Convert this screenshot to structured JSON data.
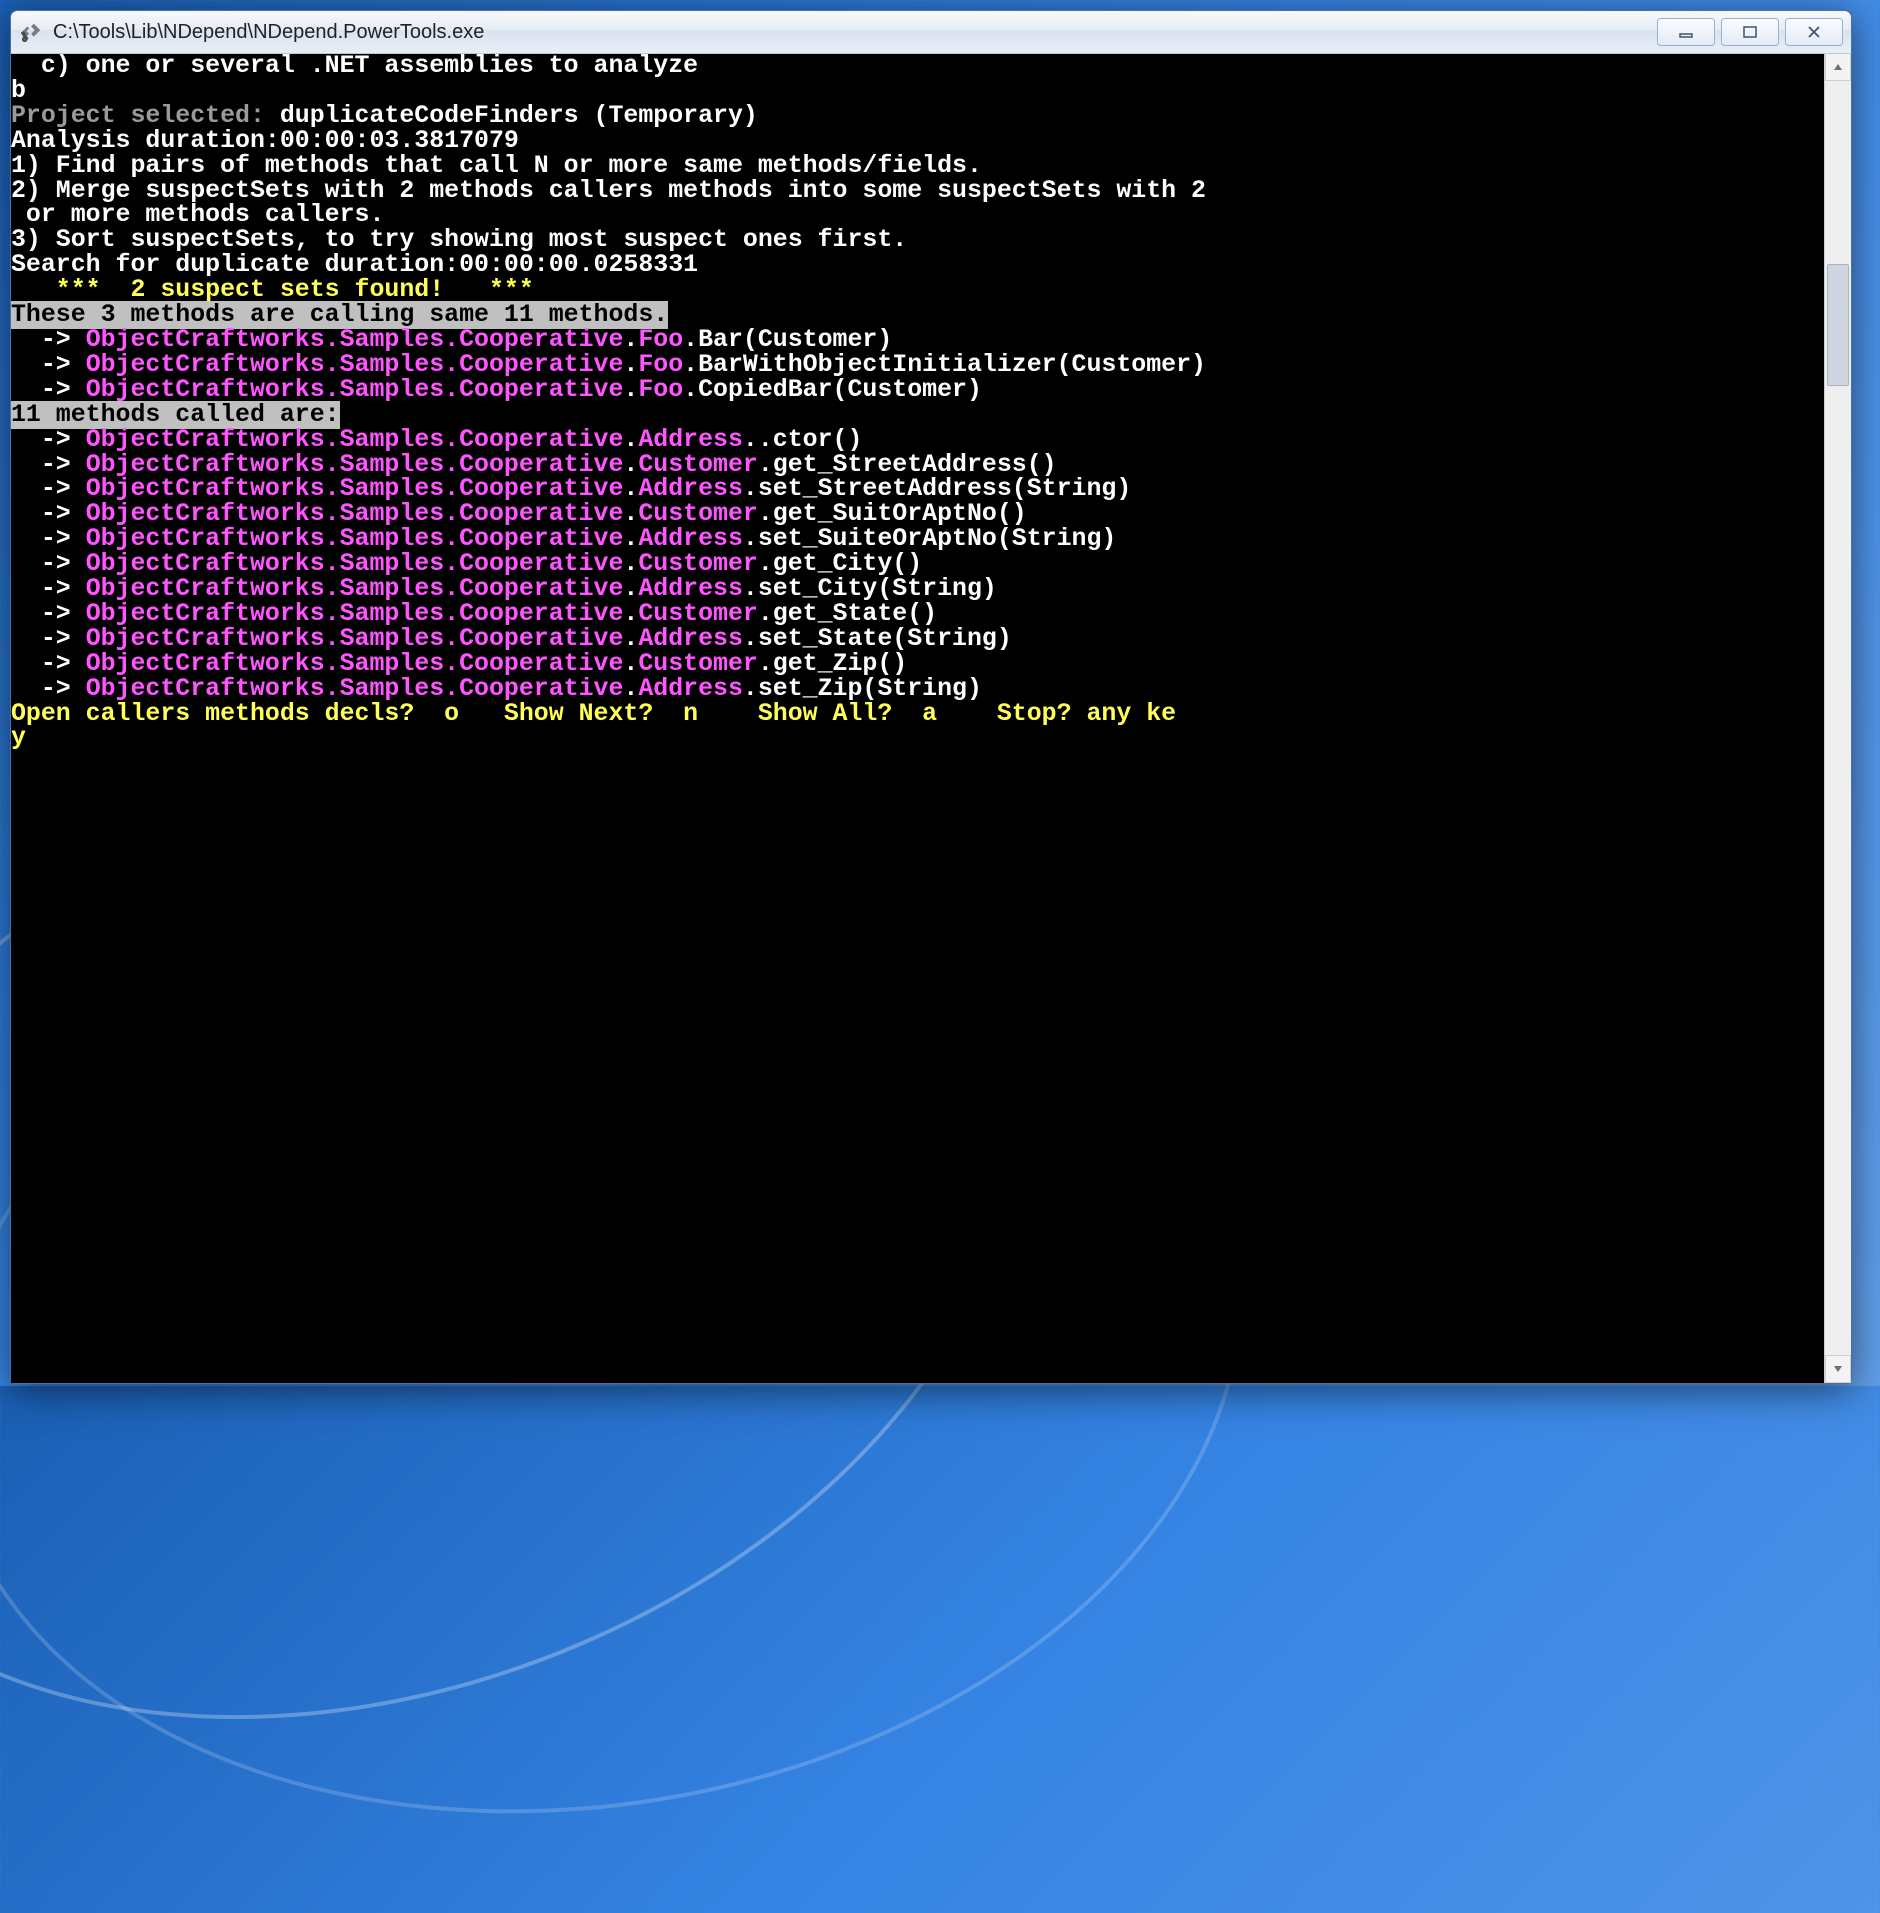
{
  "window": {
    "title": "C:\\Tools\\Lib\\NDepend\\NDepend.PowerTools.exe"
  },
  "content": {
    "option_c": "  c) one or several .NET assemblies to analyze",
    "blank1": "",
    "input_b": "b",
    "proj_label": "Project selected: ",
    "proj_value": "duplicateCodeFinders (Temporary)",
    "blank2": "",
    "analysis_duration": "Analysis duration:00:00:03.3817079",
    "step1": "1) Find pairs of methods that call N or more same methods/fields.",
    "step2a": "2) Merge suspectSets with 2 methods callers methods into some suspectSets with 2",
    "step2b": " or more methods callers.",
    "step3": "3) Sort suspectSets, to try showing most suspect ones first.",
    "search_dur": "Search for duplicate duration:00:00:00.0258331",
    "found": "   ***  2 suspect sets found!   ***",
    "header_callers": "These 3 methods are calling same 11 methods.",
    "callers": [
      {
        "namespace": "ObjectCraftworks.Samples.Cooperative",
        "type": "Foo",
        "method": "Bar(Customer)"
      },
      {
        "namespace": "ObjectCraftworks.Samples.Cooperative",
        "type": "Foo",
        "method": "BarWithObjectInitializer(Customer)"
      },
      null,
      {
        "namespace": "ObjectCraftworks.Samples.Cooperative",
        "type": "Foo",
        "method": "CopiedBar(Customer)"
      }
    ],
    "header_callees": "11 methods called are:",
    "callees": [
      {
        "namespace": "ObjectCraftworks.Samples.Cooperative",
        "type": "Address",
        "method": ".ctor()"
      },
      {
        "namespace": "ObjectCraftworks.Samples.Cooperative",
        "type": "Customer",
        "method": "get_StreetAddress()"
      },
      {
        "namespace": "ObjectCraftworks.Samples.Cooperative",
        "type": "Address",
        "method": "set_StreetAddress(String)"
      },
      {
        "namespace": "ObjectCraftworks.Samples.Cooperative",
        "type": "Customer",
        "method": "get_SuitOrAptNo()"
      },
      {
        "namespace": "ObjectCraftworks.Samples.Cooperative",
        "type": "Address",
        "method": "set_SuiteOrAptNo(String)"
      },
      {
        "namespace": "ObjectCraftworks.Samples.Cooperative",
        "type": "Customer",
        "method": "get_City()"
      },
      {
        "namespace": "ObjectCraftworks.Samples.Cooperative",
        "type": "Address",
        "method": "set_City(String)"
      },
      {
        "namespace": "ObjectCraftworks.Samples.Cooperative",
        "type": "Customer",
        "method": "get_State()"
      },
      {
        "namespace": "ObjectCraftworks.Samples.Cooperative",
        "type": "Address",
        "method": "set_State(String)"
      },
      {
        "namespace": "ObjectCraftworks.Samples.Cooperative",
        "type": "Customer",
        "method": "get_Zip()"
      },
      {
        "namespace": "ObjectCraftworks.Samples.Cooperative",
        "type": "Address",
        "method": "set_Zip(String)"
      }
    ],
    "prompt1": "Open callers methods decls?  o   Show Next?  n    Show All?  a    Stop? any ke",
    "prompt2": "y"
  }
}
